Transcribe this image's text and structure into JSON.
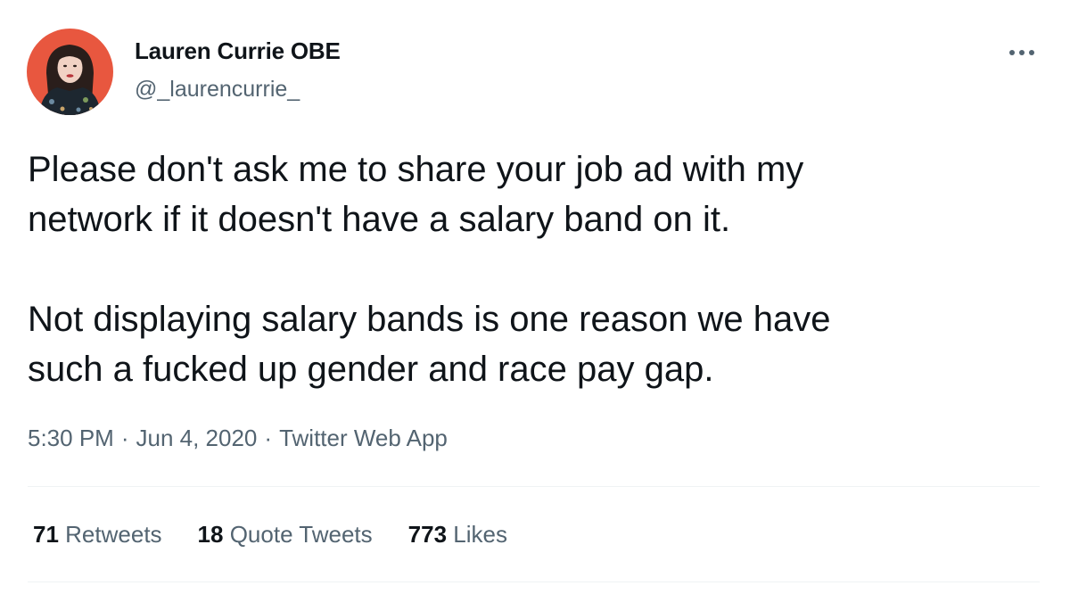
{
  "author": {
    "display_name": "Lauren Currie OBE",
    "handle": "@_laurencurrie_",
    "avatar_icon": "profile-photo",
    "avatar_bg": "#e8573f"
  },
  "more_icon": "more-horizontal-icon",
  "tweet": {
    "paragraphs": [
      "Please don't ask me to share your job ad with my\nnetwork if it doesn't have a salary band on it.",
      "Not displaying salary bands is one reason we have\nsuch a fucked up gender and race pay gap."
    ],
    "time": "5:30 PM",
    "separator": "·",
    "date": "Jun 4, 2020",
    "source": "Twitter Web App"
  },
  "stats": {
    "retweets": {
      "count": "71",
      "label": "Retweets"
    },
    "quotes": {
      "count": "18",
      "label": "Quote Tweets"
    },
    "likes": {
      "count": "773",
      "label": "Likes"
    }
  },
  "colors": {
    "text_primary": "#0f1419",
    "text_secondary": "#536471",
    "divider": "#eff3f4"
  }
}
